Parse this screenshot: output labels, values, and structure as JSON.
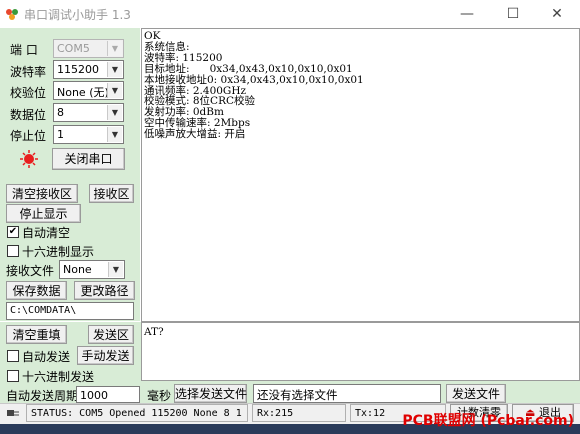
{
  "window": {
    "title": "串口调试小助手 1.3",
    "controls": {
      "minimize": "—",
      "maximize": "☐",
      "close": "✕"
    }
  },
  "port_settings": {
    "port_label": "端  口",
    "port_value": "COM5",
    "baud_label": "波特率",
    "baud_value": "115200",
    "parity_label": "校验位",
    "parity_value": "None (无)",
    "databits_label": "数据位",
    "databits_value": "8",
    "stopbits_label": "停止位",
    "stopbits_value": "1",
    "close_port_button": "关闭串口",
    "indicator_color": "#e81e1e"
  },
  "receive_controls": {
    "clear_recv_button": "清空接收区",
    "recv_area_button": "接收区",
    "stop_display_button": "停止显示",
    "auto_clear_label": "自动清空",
    "auto_clear_checked": true,
    "hex_display_label": "十六进制显示",
    "hex_display_checked": false,
    "recv_file_label": "接收文件",
    "recv_file_value": "None",
    "save_data_button": "保存数据",
    "change_path_button": "更改路径",
    "path_value": "C:\\COMDATA\\"
  },
  "receive_area": {
    "text": "OK\n系统信息:\n波特率: 115200\n目标地址:      0x34,0x43,0x10,0x10,0x01\n本地接收地址0: 0x34,0x43,0x10,0x10,0x01\n通讯频率: 2.400GHz\n校验模式: 8位CRC校验\n发射功率: 0dBm\n空中传输速率: 2Mbps\n低噪声放大增益: 开启"
  },
  "send_controls": {
    "clear_resend_button": "清空重填",
    "send_area_button": "发送区",
    "auto_send_label": "自动发送",
    "auto_send_checked": false,
    "manual_send_button": "手动发送",
    "hex_send_label": "十六进制发送",
    "hex_send_checked": false,
    "auto_period_label": "自动发送周期",
    "auto_period_value": "1000",
    "ms_label": "毫秒",
    "select_file_button": "选择发送文件",
    "file_status": "还没有选择文件",
    "send_file_button": "发送文件"
  },
  "send_area": {
    "text": "AT?"
  },
  "status_bar": {
    "status_text": "STATUS: COM5 Opened 115200 None  8  1",
    "rx_text": "Rx:215",
    "tx_text": "Tx:12",
    "reset_count_button": "计数清零",
    "exit_button": "退出"
  },
  "watermark": "PCB联盟网 (Pcbar.com)",
  "colors": {
    "panel_green": "#d8ecd6",
    "watermark_red": "#e00000"
  }
}
